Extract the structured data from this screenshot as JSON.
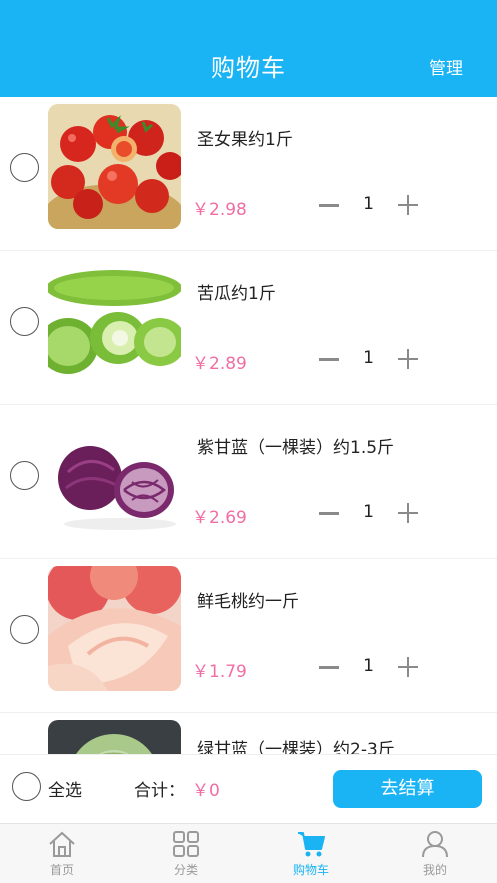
{
  "header": {
    "title": "购物车",
    "manage_label": "管理"
  },
  "cart": {
    "items": [
      {
        "name": "圣女果约1斤",
        "price": "￥2.98",
        "qty": "1"
      },
      {
        "name": "苦瓜约1斤",
        "price": "￥2.89",
        "qty": "1"
      },
      {
        "name": "紫甘蓝（一棵装）约1.5斤",
        "price": "￥2.69",
        "qty": "1"
      },
      {
        "name": "鲜毛桃约一斤",
        "price": "￥1.79",
        "qty": "1"
      },
      {
        "name": "绿甘蓝（一棵装）约2-3斤"
      }
    ]
  },
  "footer": {
    "select_all_label": "全选",
    "total_label": "合计：",
    "total_value": "￥0",
    "checkout_label": "去结算"
  },
  "tabbar": {
    "tabs": [
      {
        "label": "首页",
        "icon": "home-icon"
      },
      {
        "label": "分类",
        "icon": "grid-icon"
      },
      {
        "label": "购物车",
        "icon": "cart-icon"
      },
      {
        "label": "我的",
        "icon": "user-icon"
      }
    ],
    "active_color": "#1ab4f5",
    "inactive_color": "#9a9a9a"
  },
  "colors": {
    "brand": "#1ab4f5",
    "price": "#f06ea4"
  }
}
